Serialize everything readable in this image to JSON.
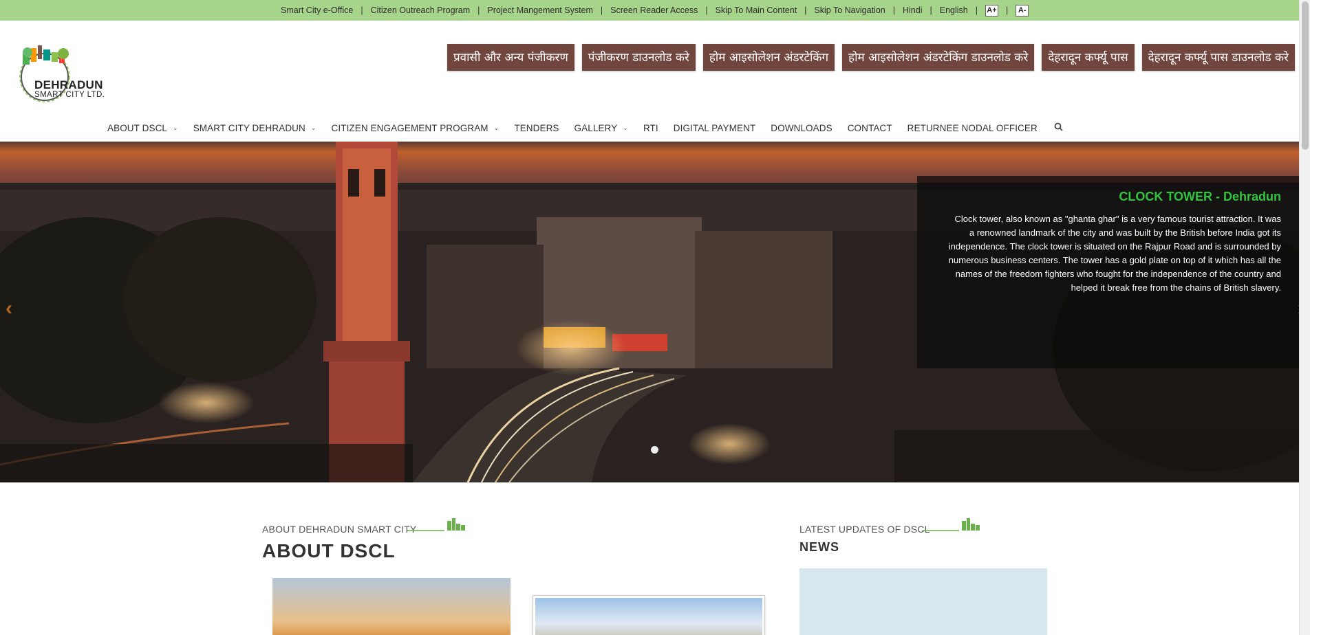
{
  "topbar": {
    "links": [
      "Smart City e-Office",
      "Citizen Outreach Program",
      "Project Mangement System",
      "Screen Reader Access",
      "Skip To Main Content",
      "Skip To Navigation",
      "Hindi",
      "English"
    ],
    "font_increase": "A+",
    "font_decrease": "A-"
  },
  "logo": {
    "line1": "DEHRADUN",
    "line2": "SMART CITY LTD."
  },
  "quick_links": [
    "प्रवासी और अन्य पंजीकरण",
    "पंजीकरण डाउनलोड करे",
    "होम आइसोलेशन अंडरटेकिंग",
    "होम आइसोलेशन अंडरटेकिंग डाउनलोड करे",
    "देहरादून कर्फ्यू पास",
    "देहरादून कर्फ्यू पास डाउनलोड करे"
  ],
  "nav": {
    "items": [
      {
        "label": "ABOUT DSCL",
        "dropdown": true
      },
      {
        "label": "SMART CITY DEHRADUN",
        "dropdown": true
      },
      {
        "label": "CITIZEN ENGAGEMENT PROGRAM",
        "dropdown": true
      },
      {
        "label": "TENDERS",
        "dropdown": false
      },
      {
        "label": "GALLERY",
        "dropdown": true
      },
      {
        "label": "RTI",
        "dropdown": false
      },
      {
        "label": "DIGITAL PAYMENT",
        "dropdown": false
      },
      {
        "label": "DOWNLOADS",
        "dropdown": false
      },
      {
        "label": "CONTACT",
        "dropdown": false
      },
      {
        "label": "RETURNEE NODAL OFFICER",
        "dropdown": false
      }
    ]
  },
  "hero": {
    "caption_title": "CLOCK TOWER - Dehradun",
    "caption_text": "Clock tower, also known as \"ghanta ghar\" is a very famous tourist attraction. It was a renowned landmark of the city and was built by the British before India got its independence. The clock tower is situated on the Rajpur Road and is surrounded by numerous business centers. The tower has a gold plate on top of it which has all the names of the freedom fighters who fought for the independence of the country and helped it break free from the chains of British slavery.",
    "prev_arrow": "‹",
    "next_arrow": "›"
  },
  "about": {
    "subtitle": "ABOUT DEHRADUN SMART CITY",
    "title": "ABOUT DSCL"
  },
  "updates": {
    "subtitle": "LATEST UPDATES OF DSCL",
    "title": "NEWS"
  },
  "colors": {
    "topbar": "#a6d48b",
    "quick_link_bg": "#70463f",
    "caption_title": "#33c43f",
    "arrow": "#b3661e",
    "news_bg": "#d6e8ee"
  }
}
